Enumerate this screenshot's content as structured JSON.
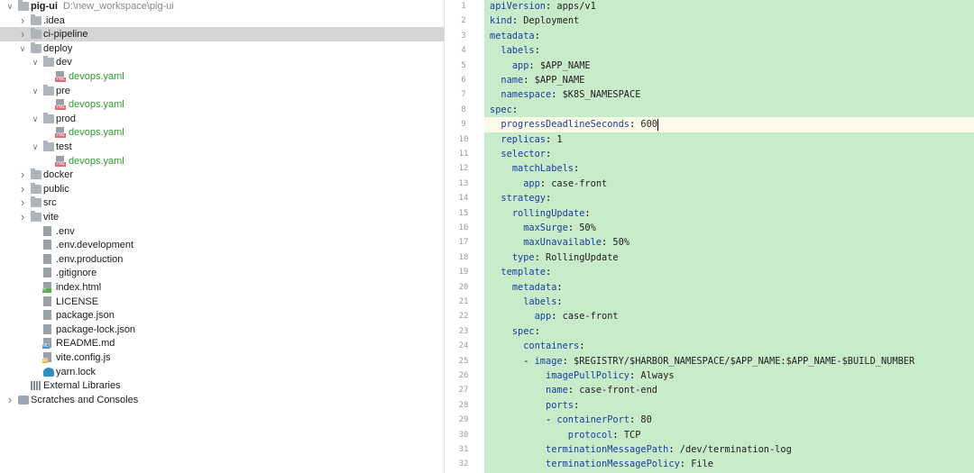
{
  "project_tree": {
    "rows": [
      {
        "level": 0,
        "expanded": true,
        "icon": "project-icon",
        "label": "pig-ui",
        "path": "D:\\new_workspace\\pig-ui",
        "bold": true
      },
      {
        "level": 1,
        "expanded": false,
        "icon": "folder-icon",
        "label": ".idea"
      },
      {
        "level": 1,
        "expanded": false,
        "icon": "folder-icon",
        "label": "ci-pipeline",
        "selected": true
      },
      {
        "level": 1,
        "expanded": true,
        "icon": "folder-icon",
        "label": "deploy"
      },
      {
        "level": 2,
        "expanded": true,
        "icon": "folder-icon",
        "label": "dev"
      },
      {
        "level": 3,
        "icon": "yaml-file-icon",
        "label": "devops.yaml",
        "green": true
      },
      {
        "level": 2,
        "expanded": true,
        "icon": "folder-icon",
        "label": "pre"
      },
      {
        "level": 3,
        "icon": "yaml-file-icon",
        "label": "devops.yaml",
        "green": true
      },
      {
        "level": 2,
        "expanded": true,
        "icon": "folder-icon",
        "label": "prod"
      },
      {
        "level": 3,
        "icon": "yaml-file-icon",
        "label": "devops.yaml",
        "green": true
      },
      {
        "level": 2,
        "expanded": true,
        "icon": "folder-icon",
        "label": "test"
      },
      {
        "level": 3,
        "icon": "yaml-file-icon",
        "label": "devops.yaml",
        "green": true
      },
      {
        "level": 1,
        "expanded": false,
        "icon": "folder-icon",
        "label": "docker"
      },
      {
        "level": 1,
        "expanded": false,
        "icon": "folder-icon",
        "label": "public"
      },
      {
        "level": 1,
        "expanded": false,
        "icon": "folder-icon",
        "label": "src"
      },
      {
        "level": 1,
        "expanded": false,
        "icon": "folder-icon",
        "label": "vite"
      },
      {
        "level": 2,
        "icon": "text-file-icon",
        "label": ".env"
      },
      {
        "level": 2,
        "icon": "text-file-icon",
        "label": ".env.development"
      },
      {
        "level": 2,
        "icon": "text-file-icon",
        "label": ".env.production"
      },
      {
        "level": 2,
        "icon": "gitignore-file-icon",
        "label": ".gitignore"
      },
      {
        "level": 2,
        "icon": "html-file-icon",
        "label": "index.html"
      },
      {
        "level": 2,
        "icon": "text-file-icon",
        "label": "LICENSE"
      },
      {
        "level": 2,
        "icon": "json-file-icon",
        "label": "package.json"
      },
      {
        "level": 2,
        "icon": "json-file-icon",
        "label": "package-lock.json"
      },
      {
        "level": 2,
        "icon": "markdown-file-icon",
        "label": "README.md"
      },
      {
        "level": 2,
        "icon": "js-file-icon",
        "label": "vite.config.js"
      },
      {
        "level": 2,
        "icon": "yarn-icon",
        "label": "yarn.lock"
      },
      {
        "level": 1,
        "icon": "library-icon",
        "label": "External Libraries"
      },
      {
        "level": 0,
        "expanded": false,
        "icon": "scratches-icon",
        "label": "Scratches and Consoles"
      }
    ]
  },
  "editor": {
    "current_line": 9,
    "lines": [
      {
        "n": "1",
        "i": 0,
        "k": "apiVersion",
        "v": "apps/v1"
      },
      {
        "n": "2",
        "i": 0,
        "k": "kind",
        "v": "Deployment"
      },
      {
        "n": "3",
        "i": 0,
        "k": "metadata",
        "v": ""
      },
      {
        "n": "4",
        "i": 1,
        "k": "labels",
        "v": ""
      },
      {
        "n": "5",
        "i": 2,
        "k": "app",
        "v": "$APP_NAME"
      },
      {
        "n": "6",
        "i": 1,
        "k": "name",
        "v": "$APP_NAME"
      },
      {
        "n": "7",
        "i": 1,
        "k": "namespace",
        "v": "$K8S_NAMESPACE"
      },
      {
        "n": "8",
        "i": 0,
        "k": "spec",
        "v": ""
      },
      {
        "n": "9",
        "i": 1,
        "k": "progressDeadlineSeconds",
        "v": "600"
      },
      {
        "n": "10",
        "i": 1,
        "k": "replicas",
        "v": "1"
      },
      {
        "n": "11",
        "i": 1,
        "k": "selector",
        "v": ""
      },
      {
        "n": "12",
        "i": 2,
        "k": "matchLabels",
        "v": ""
      },
      {
        "n": "13",
        "i": 3,
        "k": "app",
        "v": "case-front"
      },
      {
        "n": "14",
        "i": 1,
        "k": "strategy",
        "v": ""
      },
      {
        "n": "15",
        "i": 2,
        "k": "rollingUpdate",
        "v": ""
      },
      {
        "n": "16",
        "i": 3,
        "k": "maxSurge",
        "v": "50%"
      },
      {
        "n": "17",
        "i": 3,
        "k": "maxUnavailable",
        "v": "50%"
      },
      {
        "n": "18",
        "i": 2,
        "k": "type",
        "v": "RollingUpdate"
      },
      {
        "n": "19",
        "i": 1,
        "k": "template",
        "v": ""
      },
      {
        "n": "20",
        "i": 2,
        "k": "metadata",
        "v": ""
      },
      {
        "n": "21",
        "i": 3,
        "k": "labels",
        "v": ""
      },
      {
        "n": "22",
        "i": 4,
        "k": "app",
        "v": "case-front"
      },
      {
        "n": "23",
        "i": 2,
        "k": "spec",
        "v": ""
      },
      {
        "n": "24",
        "i": 3,
        "k": "containers",
        "v": ""
      },
      {
        "n": "25",
        "i": 4,
        "d": true,
        "k": "image",
        "v": "$REGISTRY/$HARBOR_NAMESPACE/$APP_NAME:$APP_NAME-$BUILD_NUMBER"
      },
      {
        "n": "26",
        "i": 5,
        "k": "imagePullPolicy",
        "v": "Always"
      },
      {
        "n": "27",
        "i": 5,
        "k": "name",
        "v": "case-front-end"
      },
      {
        "n": "28",
        "i": 5,
        "k": "ports",
        "v": ""
      },
      {
        "n": "29",
        "i": 6,
        "d": true,
        "k": "containerPort",
        "v": "80"
      },
      {
        "n": "30",
        "i": 7,
        "k": "protocol",
        "v": "TCP"
      },
      {
        "n": "31",
        "i": 5,
        "k": "terminationMessagePath",
        "v": "/dev/termination-log"
      },
      {
        "n": "32",
        "i": 5,
        "k": "terminationMessagePolicy",
        "v": "File"
      }
    ]
  }
}
